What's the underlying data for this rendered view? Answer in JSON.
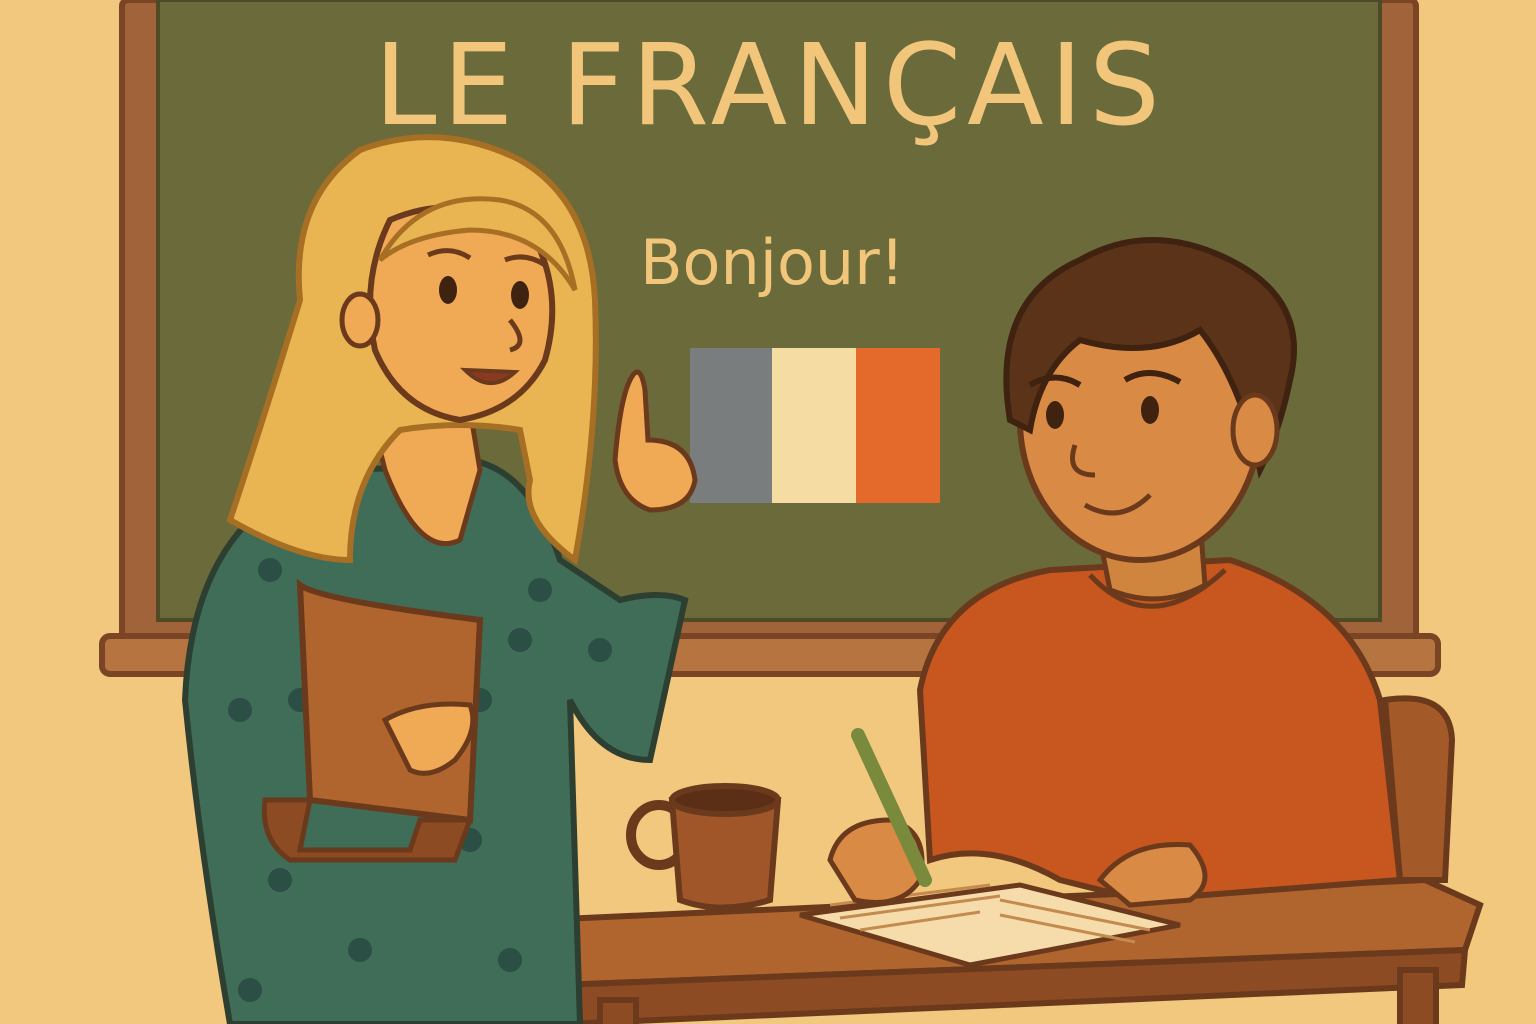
{
  "chalkboard": {
    "title": "LE FRANÇAIS",
    "greeting": "Bonjour!"
  },
  "palette": {
    "wall": "#f2c77e",
    "board": "#6a6a3a",
    "frame": "#a0633a",
    "chalk": "#f1c67a",
    "flag_blue": "#7a7d7e",
    "flag_white": "#f4dca2",
    "flag_red": "#e46a2c"
  }
}
